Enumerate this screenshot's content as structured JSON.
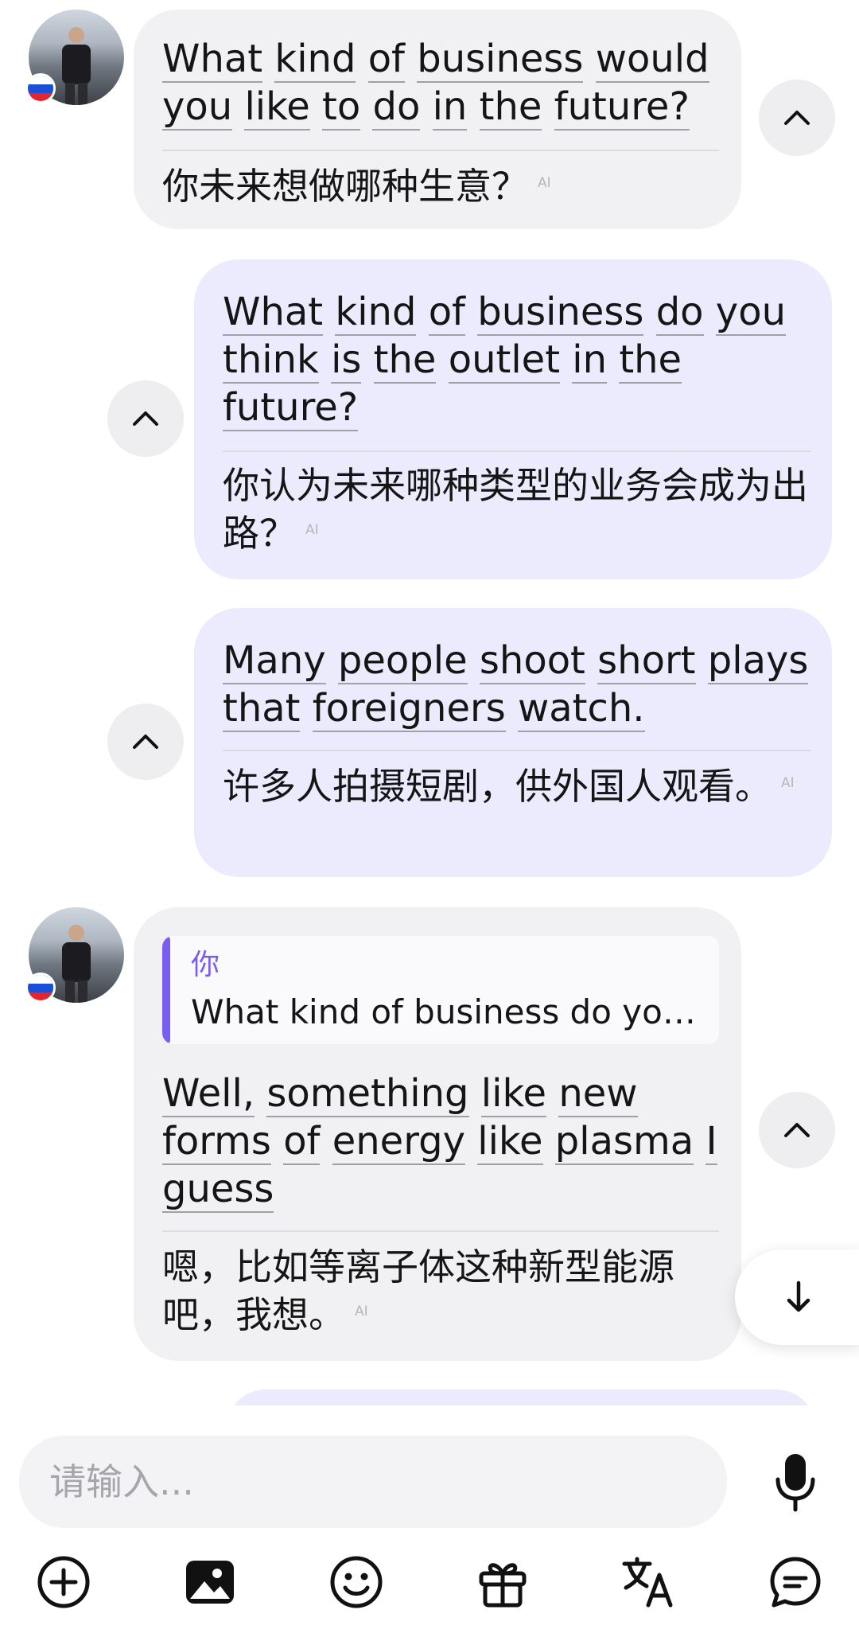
{
  "messages": [
    {
      "side": "incoming",
      "en_words": [
        "What",
        "kind",
        "of",
        "business",
        "would",
        "you",
        "like",
        "to",
        "do",
        "in",
        "the",
        "future?"
      ],
      "zh": "你未来想做哪种生意？",
      "ai": "AI"
    },
    {
      "side": "outgoing",
      "en_words": [
        "What",
        "kind",
        "of",
        "business",
        "do",
        "you",
        "think",
        "is",
        "the",
        "outlet",
        "in",
        "the",
        "future?"
      ],
      "zh": "你认为未来哪种类型的业务会成为出路？",
      "ai": "AI"
    },
    {
      "side": "outgoing",
      "en_words": [
        "Many",
        "people",
        "shoot",
        "short",
        "plays",
        "that",
        "foreigners",
        "watch."
      ],
      "zh": "许多人拍摄短剧，供外国人观看。",
      "ai": "AI"
    },
    {
      "side": "incoming",
      "quote": {
        "author": "你",
        "text": "What kind of business do yo…"
      },
      "en_words": [
        "Well,",
        "something",
        "like",
        "new",
        "forms",
        "of",
        "energy",
        "like",
        "plasma",
        "I",
        "guess"
      ],
      "zh": "嗯，比如等离子体这种新型能源吧，我想。",
      "ai": "AI"
    }
  ],
  "input": {
    "placeholder": "请输入..."
  },
  "toolbar": [
    "add-icon",
    "image-icon",
    "emoji-icon",
    "gift-icon",
    "translate-icon",
    "chat-icon"
  ],
  "colors": {
    "incoming_bubble": "#f1f1f3",
    "outgoing_bubble": "#ecebfe",
    "quote_accent": "#7b5cf0"
  }
}
